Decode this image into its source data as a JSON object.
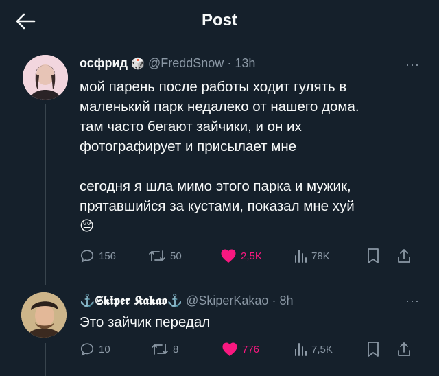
{
  "header": {
    "title": "Post"
  },
  "tweets": [
    {
      "display_name": "осфрид",
      "emoji": "🎲",
      "handle": "@FreddSnow",
      "separator": "·",
      "time": "13h",
      "more": "···",
      "text_lines": [
        "мой парень после работы ходит гулять в",
        "маленький парк недалеко от нашего дома.",
        "там часто бегают зайчики, и он их",
        "фотографирует и присылает мне",
        "сегодня я шла мимо этого парка и мужик,",
        "прятавшийся за кустами, показал мне хуй",
        "😔"
      ],
      "stats": {
        "replies": "156",
        "reposts": "50",
        "likes": "2,5K",
        "views": "78K"
      }
    },
    {
      "display_name": "⚓𝕾𝖐𝖎𝖕𝖊𝖗 𝕶𝖆𝖐𝖆𝖔⚓",
      "handle": "@SkiperKakao",
      "separator": "·",
      "time": "8h",
      "more": "···",
      "text_lines": [
        "Это зайчик передал"
      ],
      "stats": {
        "replies": "10",
        "reposts": "8",
        "likes": "776",
        "views": "7,5K"
      }
    }
  ],
  "colors": {
    "background": "#15202b",
    "muted": "#8b98a5",
    "like": "#f91880",
    "text": "#f7f9f9"
  },
  "icons": [
    "back-arrow-icon",
    "dice-icon",
    "more-icon",
    "reply-icon",
    "repost-icon",
    "heart-icon",
    "views-icon",
    "bookmark-icon",
    "share-icon"
  ]
}
